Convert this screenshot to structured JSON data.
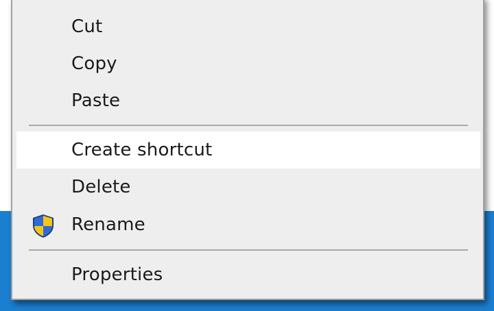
{
  "context_menu": {
    "items": [
      {
        "label": "Cut"
      },
      {
        "label": "Copy"
      },
      {
        "label": "Paste"
      },
      {
        "label": "Create shortcut",
        "highlighted": true
      },
      {
        "label": "Delete"
      },
      {
        "label": "Rename",
        "icon": "uac-shield-icon"
      },
      {
        "label": "Properties"
      }
    ]
  },
  "colors": {
    "menu_background": "#eeeeee",
    "highlight": "#ffffff",
    "desktop": "#1b7fd0",
    "shield_blue": "#2f6bd8",
    "shield_yellow": "#f5c518"
  }
}
